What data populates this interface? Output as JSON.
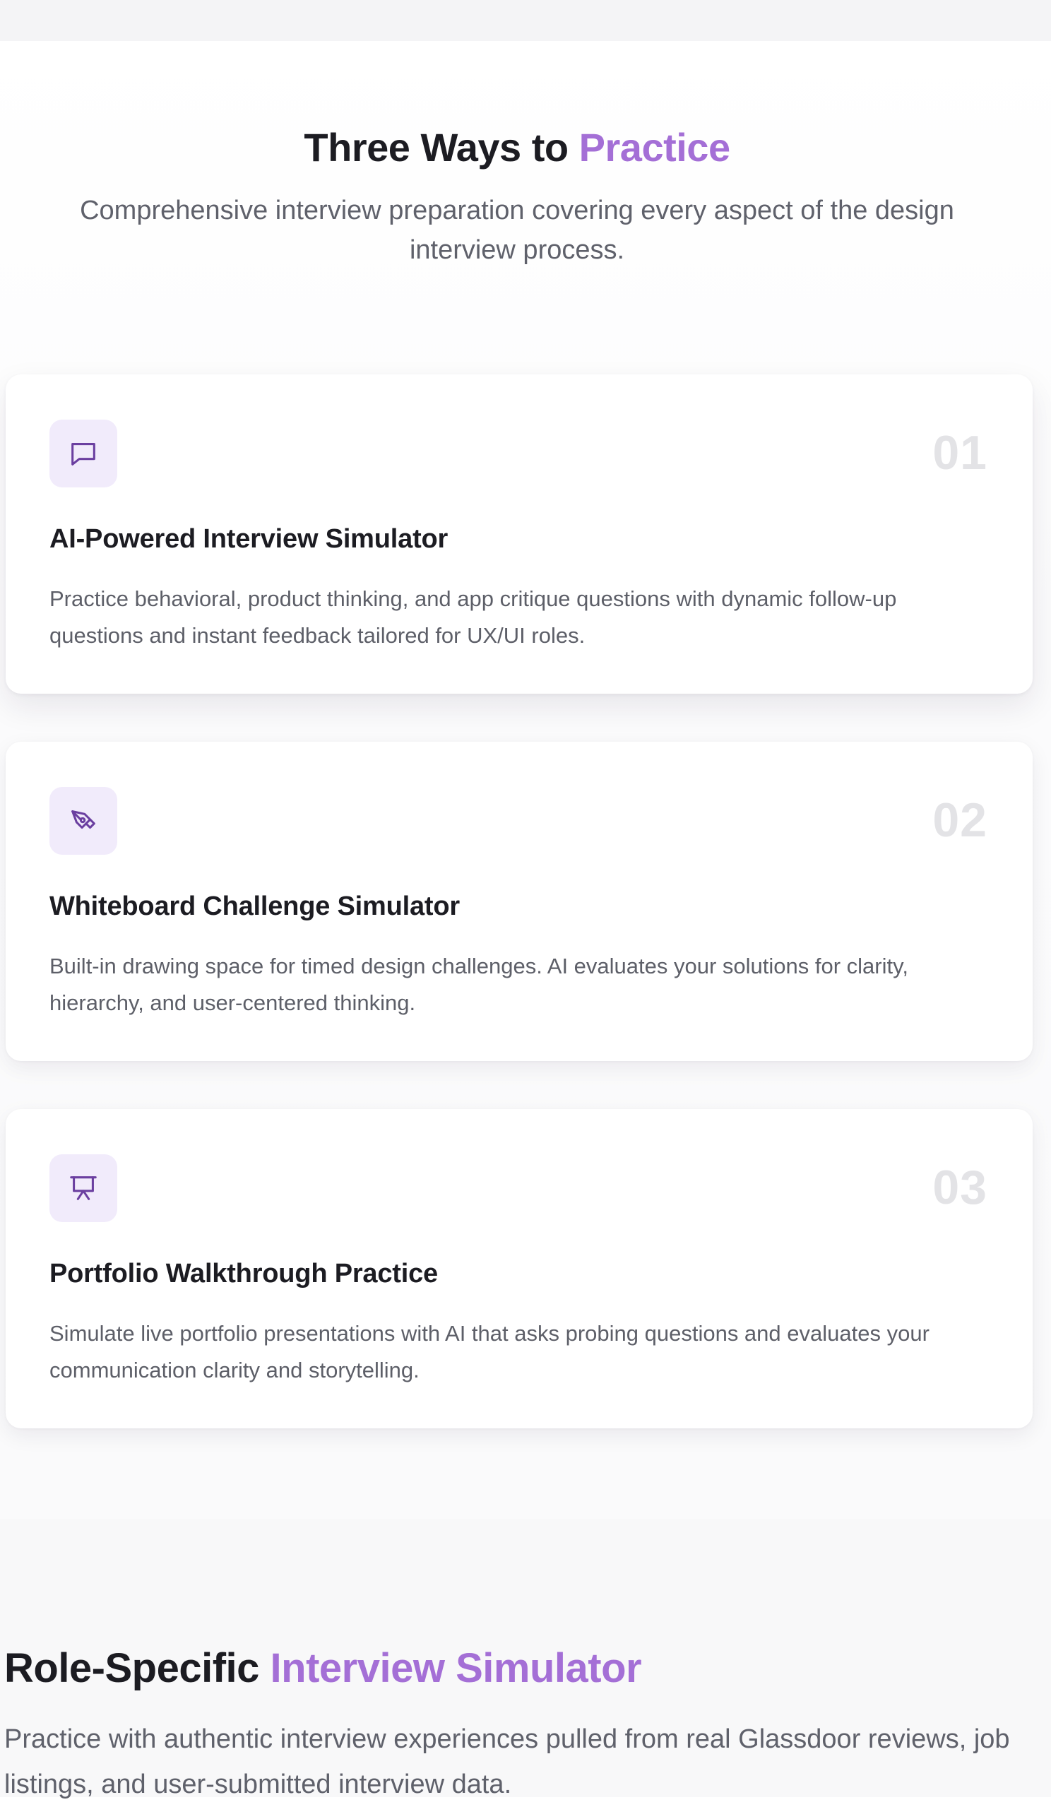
{
  "features_section": {
    "title_prefix": "Three Ways to ",
    "title_accent": "Practice",
    "subtitle": "Comprehensive interview preparation covering every aspect of the design interview process.",
    "cards": [
      {
        "number": "01",
        "icon": "chat-bubble-icon",
        "title": "AI-Powered Interview Simulator",
        "description": "Practice behavioral, product thinking, and app critique questions with dynamic follow-up questions and instant feedback tailored for UX/UI roles."
      },
      {
        "number": "02",
        "icon": "pen-tool-icon",
        "title": "Whiteboard Challenge Simulator",
        "description": "Built-in drawing space for timed design challenges. AI evaluates your solutions for clarity, hierarchy, and user-centered thinking."
      },
      {
        "number": "03",
        "icon": "presentation-icon",
        "title": "Portfolio Walkthrough Practice",
        "description": "Simulate live portfolio presentations with AI that asks probing questions and evaluates your communication clarity and storytelling."
      }
    ]
  },
  "role_section": {
    "title_prefix": "Role-Specific ",
    "title_accent": "Interview Simulator",
    "subtitle": "Practice with authentic interview experiences pulled from real Glassdoor reviews, job listings, and user-submitted interview data."
  },
  "colors": {
    "accent": "#a46fd6",
    "icon_bg": "#f1ebfb",
    "icon_stroke": "#6b3fa0",
    "number": "#e3e3e6"
  }
}
